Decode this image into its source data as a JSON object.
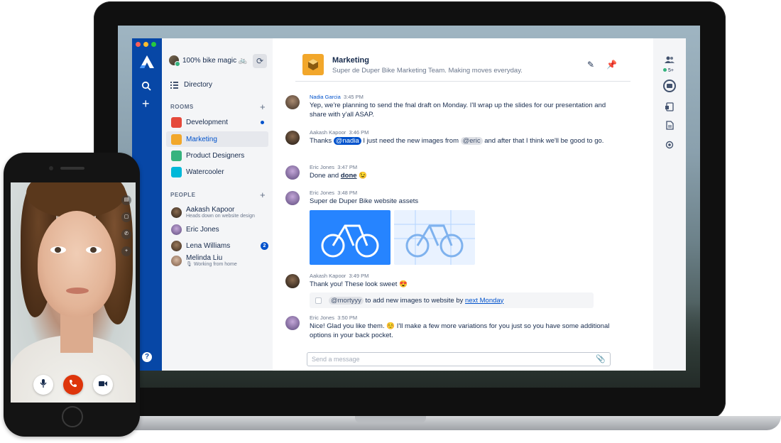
{
  "team": {
    "name": "100% bike magic 🚲"
  },
  "sidebar": {
    "directory_label": "Directory",
    "rooms_label": "ROOMS",
    "people_label": "PEOPLE",
    "rooms": [
      {
        "label": "Development",
        "color": "#e5493a",
        "unread": true,
        "active": false
      },
      {
        "label": "Marketing",
        "color": "#f2a72b",
        "unread": false,
        "active": true
      },
      {
        "label": "Product Designers",
        "color": "#36b37e",
        "unread": false,
        "active": false
      },
      {
        "label": "Watercooler",
        "color": "#00b8d9",
        "unread": false,
        "active": false
      }
    ],
    "people": [
      {
        "name": "Aakash Kapoor",
        "status": "Heads down on website design"
      },
      {
        "name": "Eric Jones",
        "status": ""
      },
      {
        "name": "Lena Williams",
        "status": "",
        "badge": "2"
      },
      {
        "name": "Melinda Liu",
        "status": "🎙 Working from home"
      }
    ]
  },
  "room": {
    "name": "Marketing",
    "topic": "Super de Duper Bike Marketing Team. Making moves everyday."
  },
  "messages": [
    {
      "author": "Nadia Garcia",
      "time": "3:45 PM",
      "text": "Yep, we're planning to send the fnal draft on Monday. I'll wrap up the slides for our presentation and share with y'all ASAP."
    },
    {
      "author": "Aakash Kapoor",
      "time": "3:46 PM",
      "pre": "Thanks",
      "mention1": "@nadia",
      "mid": "I just need the new images from",
      "mention2": "@eric",
      "post": "and after that I think we'll be good to go."
    },
    {
      "author": "Eric Jones",
      "time": "3:47 PM",
      "pre": "Done and",
      "bold": "done",
      "emoji": "😉"
    },
    {
      "author": "Eric Jones",
      "time": "3:48 PM",
      "text": "Super de Duper Bike website assets"
    },
    {
      "author": "Aakash Kapoor",
      "time": "3:49 PM",
      "text": "Thank you! These look sweet 😍"
    },
    {
      "author": "Eric Jones",
      "time": "3:50 PM",
      "text": "Nice! Glad you like them. ☺️ I'll make a few more variations for you just so you have some additional options in your back pocket."
    }
  ],
  "task": {
    "mention": "@mortyyy",
    "text": "to add new images to website by",
    "link": "next Monday"
  },
  "composer": {
    "placeholder": "Send a message"
  },
  "rail": {
    "participants": "5+"
  },
  "colors": {
    "nav": "#0747a6",
    "accent": "#0052cc",
    "end_call": "#de350b"
  }
}
